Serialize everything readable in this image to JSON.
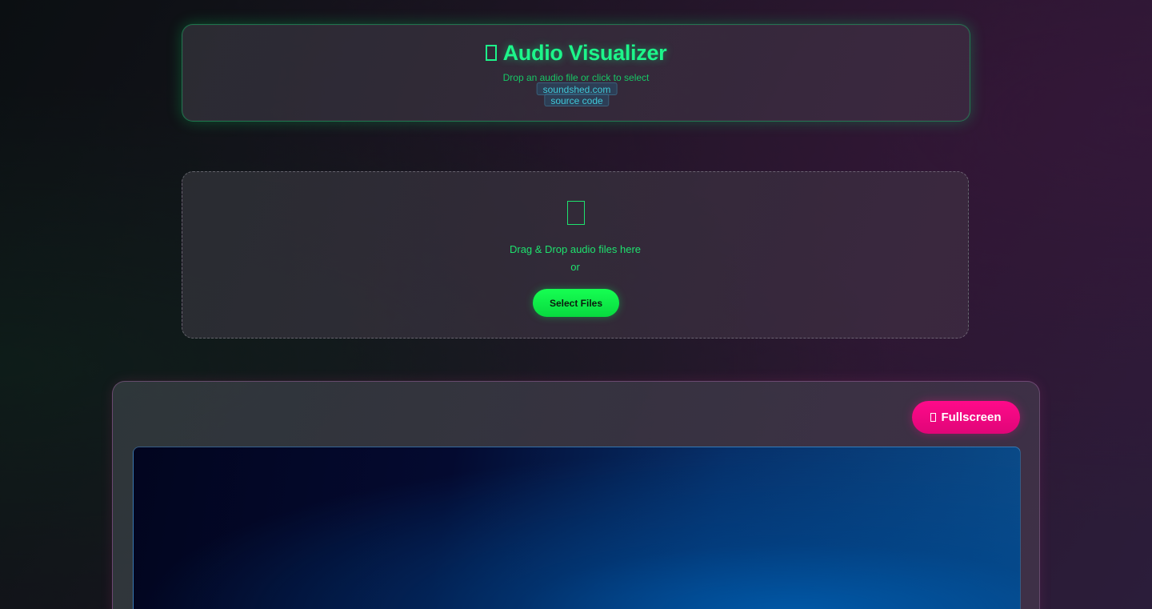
{
  "header": {
    "title": "Audio Visualizer",
    "title_icon": "music-note-icon",
    "subtitle": "Drop an audio file or click to select",
    "links": [
      "soundshed.com",
      "source code"
    ]
  },
  "drop_zone": {
    "icon": "music-note-icon",
    "text": "Drag & Drop audio files here",
    "or_text": "or",
    "select_label": "Select Files"
  },
  "visualizer": {
    "fullscreen_label": "Fullscreen",
    "fullscreen_icon": "expand-icon"
  },
  "colors": {
    "accent_green": "#1df58a",
    "button_green": "#16ff52",
    "accent_pink": "#ff0a8a",
    "link_cyan": "#3fc8d8"
  }
}
